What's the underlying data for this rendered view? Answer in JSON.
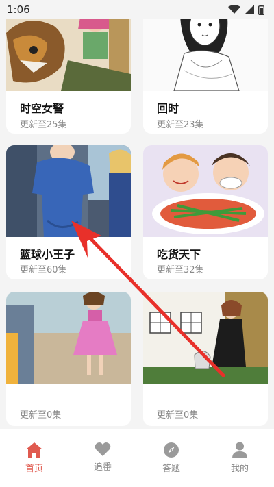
{
  "status_bar": {
    "time": "1:06"
  },
  "comics": [
    {
      "title": "时空女警",
      "update": "更新至25集"
    },
    {
      "title": "回时",
      "update": "更新至23集"
    },
    {
      "title": "篮球小王子",
      "update": "更新至60集"
    },
    {
      "title": "吃货天下",
      "update": "更新至32集"
    },
    {
      "title": "",
      "update": "更新至0集"
    },
    {
      "title": "",
      "update": "更新至0集"
    }
  ],
  "tabbar": {
    "tabs": [
      {
        "label": "首页",
        "icon": "home-icon",
        "active": true
      },
      {
        "label": "追番",
        "icon": "heart-icon",
        "active": false
      },
      {
        "label": "答题",
        "icon": "compass-icon",
        "active": false
      },
      {
        "label": "我的",
        "icon": "user-icon",
        "active": false
      }
    ]
  },
  "colors": {
    "accent": "#e05a4f",
    "inactive": "#8a8a8a",
    "annotation": "#e8302a"
  }
}
